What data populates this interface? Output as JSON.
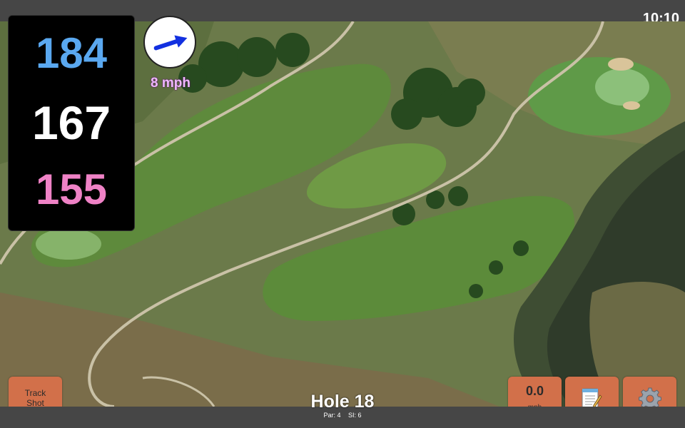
{
  "status_bar": {
    "time": "10:10"
  },
  "distances": {
    "back": "184",
    "middle": "167",
    "front": "155"
  },
  "wind": {
    "speed": "8 mph",
    "direction_icon": "arrow-up-right-icon"
  },
  "hole": {
    "title": "Hole 18",
    "par": "Par: 4",
    "stroke_index": "SI: 6"
  },
  "buttons": {
    "track_shot_line1": "Track",
    "track_shot_line2": "Shot",
    "speed_value": "0.0",
    "speed_unit": "mph",
    "notes_icon": "notepad-icon",
    "settings_icon": "gear-icon"
  },
  "colors": {
    "back_distance": "#5aa8f0",
    "middle_distance": "#ffffff",
    "front_distance": "#ef82c6",
    "button": "#d2704a",
    "wind_arrow": "#1230e0"
  }
}
